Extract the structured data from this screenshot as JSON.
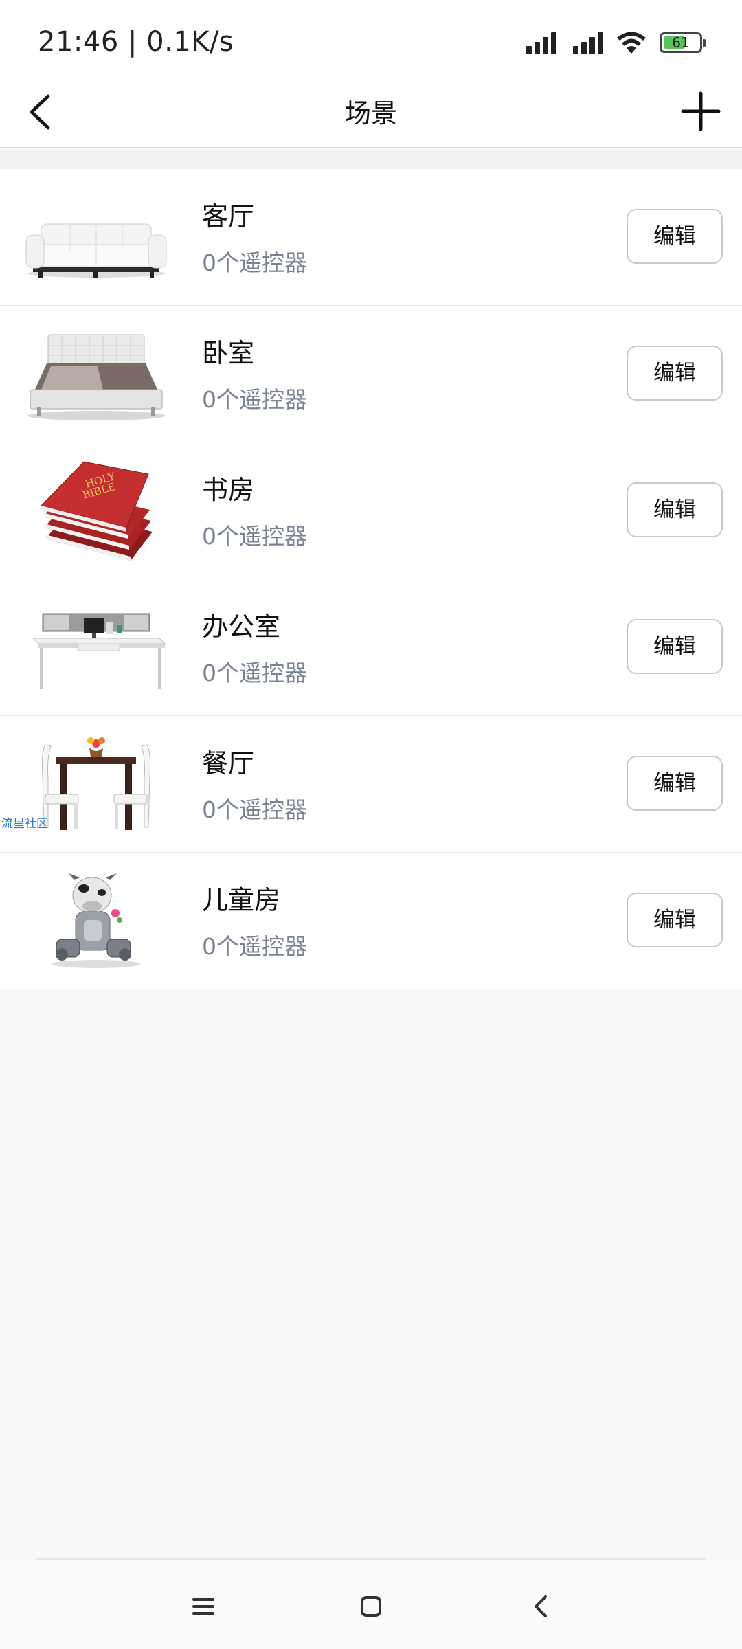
{
  "status_bar": {
    "time": "21:46 | 0.1K/s",
    "battery_level": "61",
    "battery_percent": 61,
    "icons": [
      "signal-icon",
      "signal-icon",
      "wifi-icon",
      "battery-icon"
    ]
  },
  "header": {
    "title": "场景",
    "back_icon": "chevron-left-icon",
    "add_icon": "plus-icon"
  },
  "scenes": [
    {
      "name": "客厅",
      "count": "0个遥控器",
      "edit_label": "编辑",
      "thumbnail": "sofa-image"
    },
    {
      "name": "卧室",
      "count": "0个遥控器",
      "edit_label": "编辑",
      "thumbnail": "bed-image"
    },
    {
      "name": "书房",
      "count": "0个遥控器",
      "edit_label": "编辑",
      "thumbnail": "books-image"
    },
    {
      "name": "办公室",
      "count": "0个遥控器",
      "edit_label": "编辑",
      "thumbnail": "desk-image"
    },
    {
      "name": "餐厅",
      "count": "0个遥控器",
      "edit_label": "编辑",
      "thumbnail": "dining-table-image",
      "watermark": "流星社区"
    },
    {
      "name": "儿童房",
      "count": "0个遥控器",
      "edit_label": "编辑",
      "thumbnail": "toy-robot-image"
    }
  ],
  "nav_bar": {
    "icons": [
      "menu-icon",
      "home-square-icon",
      "back-triangle-icon"
    ]
  },
  "colors": {
    "background": "#f8f8f8",
    "card": "#ffffff",
    "secondary_text": "#7a8391",
    "battery_green": "#5ac35a",
    "watermark_blue": "#2a7bd4"
  }
}
